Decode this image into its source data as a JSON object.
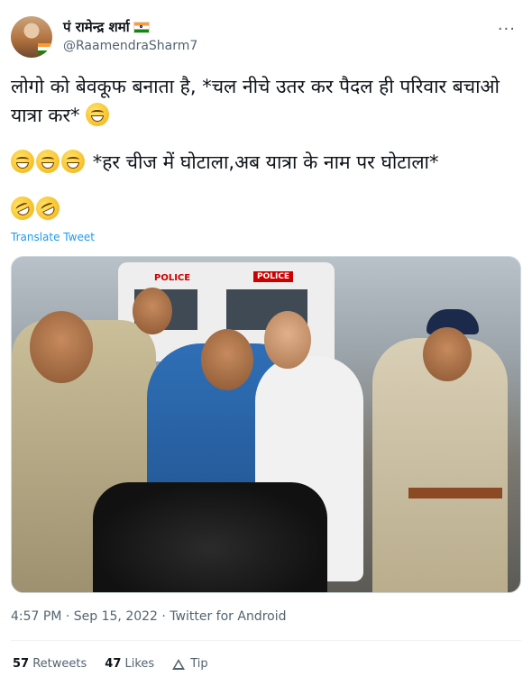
{
  "author": {
    "display_name": "पं रामेन्द्र शर्मा",
    "handle": "@RaamendraSharm7",
    "flag_icon": "india-flag-icon"
  },
  "more_label": "···",
  "tweet": {
    "line1_before_emoji": "लोगो को बेवकूफ बनाता है, *चल नीचे उतर कर पैदल ही परिवार बचाओ  यात्रा कर*",
    "line2_after_emoji": "*हर चीज में घोटाला,अब यात्रा के नाम पर घोटाला*",
    "translate_label": "Translate Tweet"
  },
  "media": {
    "van_label_left": "POLICE",
    "van_label_right": "POLICE"
  },
  "meta": {
    "text": "4:57 PM · Sep 15, 2022 · Twitter for Android"
  },
  "stats": {
    "retweets_count": "57",
    "retweets_label": "Retweets",
    "likes_count": "47",
    "likes_label": "Likes",
    "tip_label": "Tip"
  },
  "colors": {
    "link": "#1d9bf0",
    "secondary_text": "#536471"
  }
}
